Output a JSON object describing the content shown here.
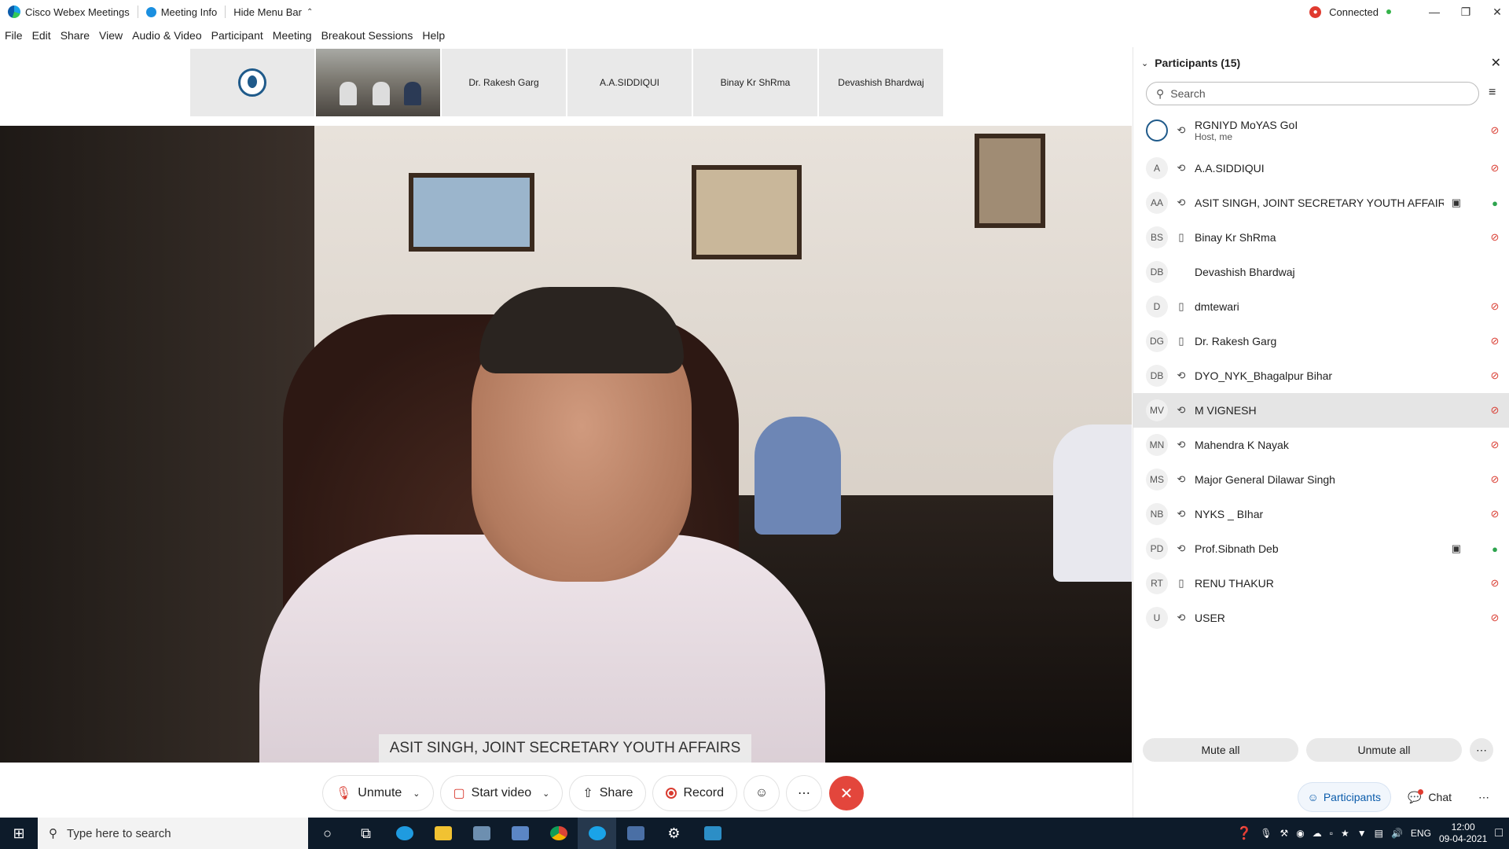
{
  "titlebar": {
    "app_title": "Cisco Webex Meetings",
    "meeting_info": "Meeting Info",
    "hide_menu": "Hide Menu Bar",
    "status": "Connected"
  },
  "menu": [
    "File",
    "Edit",
    "Share",
    "View",
    "Audio & Video",
    "Participant",
    "Meeting",
    "Breakout Sessions",
    "Help"
  ],
  "thumbnails": [
    "Dr. Rakesh Garg",
    "A.A.SIDDIQUI",
    "Binay Kr ShRma",
    "Devashish Bhardwaj"
  ],
  "active_speaker": "ASIT SINGH, JOINT SECRETARY YOUTH AFFAIRS",
  "controls": {
    "unmute": "Unmute",
    "start_video": "Start video",
    "share": "Share",
    "record": "Record"
  },
  "panel": {
    "title": "Participants (15)",
    "search_placeholder": "Search",
    "mute_all": "Mute all",
    "unmute_all": "Unmute all",
    "tab_participants": "Participants",
    "tab_chat": "Chat",
    "participants": [
      {
        "initials": "",
        "name": "RGNIYD MoYAS GoI",
        "sub": "Host, me",
        "device": "audio",
        "mic": "muted",
        "video": false
      },
      {
        "initials": "A",
        "name": "A.A.SIDDIQUI",
        "sub": "",
        "device": "audio",
        "mic": "muted",
        "video": false
      },
      {
        "initials": "AA",
        "name": "ASIT SINGH, JOINT SECRETARY YOUTH AFFAIRS",
        "sub": "",
        "device": "audio",
        "mic": "on",
        "video": true
      },
      {
        "initials": "BS",
        "name": "Binay Kr ShRma",
        "sub": "",
        "device": "phone",
        "mic": "muted",
        "video": false
      },
      {
        "initials": "DB",
        "name": "Devashish Bhardwaj",
        "sub": "",
        "device": "none",
        "mic": "none",
        "video": false
      },
      {
        "initials": "D",
        "name": "dmtewari",
        "sub": "",
        "device": "phone",
        "mic": "muted",
        "video": false
      },
      {
        "initials": "DG",
        "name": "Dr. Rakesh Garg",
        "sub": "",
        "device": "phone",
        "mic": "muted",
        "video": false
      },
      {
        "initials": "DB",
        "name": "DYO_NYK_Bhagalpur Bihar",
        "sub": "",
        "device": "audio",
        "mic": "muted",
        "video": false
      },
      {
        "initials": "MV",
        "name": "M VIGNESH",
        "sub": "",
        "device": "audio",
        "mic": "muted",
        "video": false
      },
      {
        "initials": "MN",
        "name": "Mahendra K Nayak",
        "sub": "",
        "device": "audio",
        "mic": "muted",
        "video": false
      },
      {
        "initials": "MS",
        "name": "Major General Dilawar Singh",
        "sub": "",
        "device": "audio",
        "mic": "muted",
        "video": false
      },
      {
        "initials": "NB",
        "name": "NYKS _ BIhar",
        "sub": "",
        "device": "audio",
        "mic": "muted",
        "video": false
      },
      {
        "initials": "PD",
        "name": "Prof.Sibnath Deb",
        "sub": "",
        "device": "audio",
        "mic": "on",
        "video": true
      },
      {
        "initials": "RT",
        "name": "RENU THAKUR",
        "sub": "",
        "device": "phone",
        "mic": "muted",
        "video": false
      },
      {
        "initials": "U",
        "name": "USER",
        "sub": "",
        "device": "audio",
        "mic": "muted",
        "video": false
      }
    ]
  },
  "taskbar": {
    "search_placeholder": "Type here to search",
    "lang": "ENG",
    "time": "12:00",
    "date": "09-04-2021"
  },
  "colors": {
    "accent": "#0b5cab",
    "end_call": "#e3463c",
    "muted": "#d93b30",
    "unmuted": "#2da44e"
  }
}
